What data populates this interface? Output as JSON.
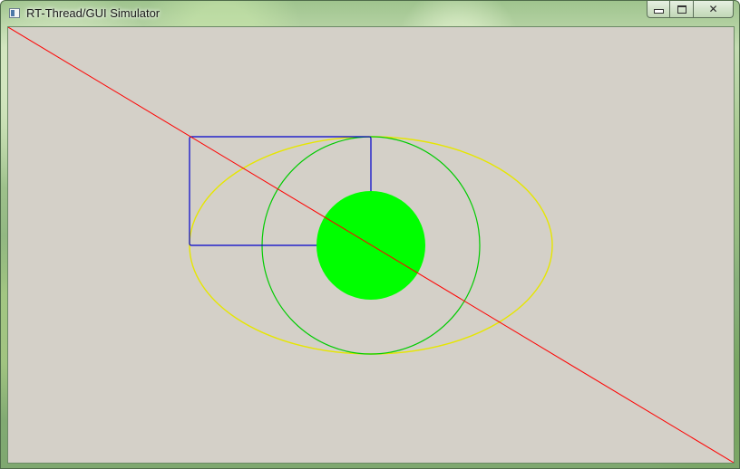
{
  "window": {
    "title": "RT-Thread/GUI Simulator",
    "icon": "app-icon",
    "controls": [
      "minimize-icon",
      "maximize-icon",
      "close-icon"
    ]
  },
  "canvas": {
    "background": "#d4d0c8",
    "colors": {
      "line": "#ff0000",
      "rectangle": "#0000cc",
      "ellipse": "#e6e600",
      "circle": "#00cc00",
      "filled_circle": "#00ff00"
    }
  }
}
